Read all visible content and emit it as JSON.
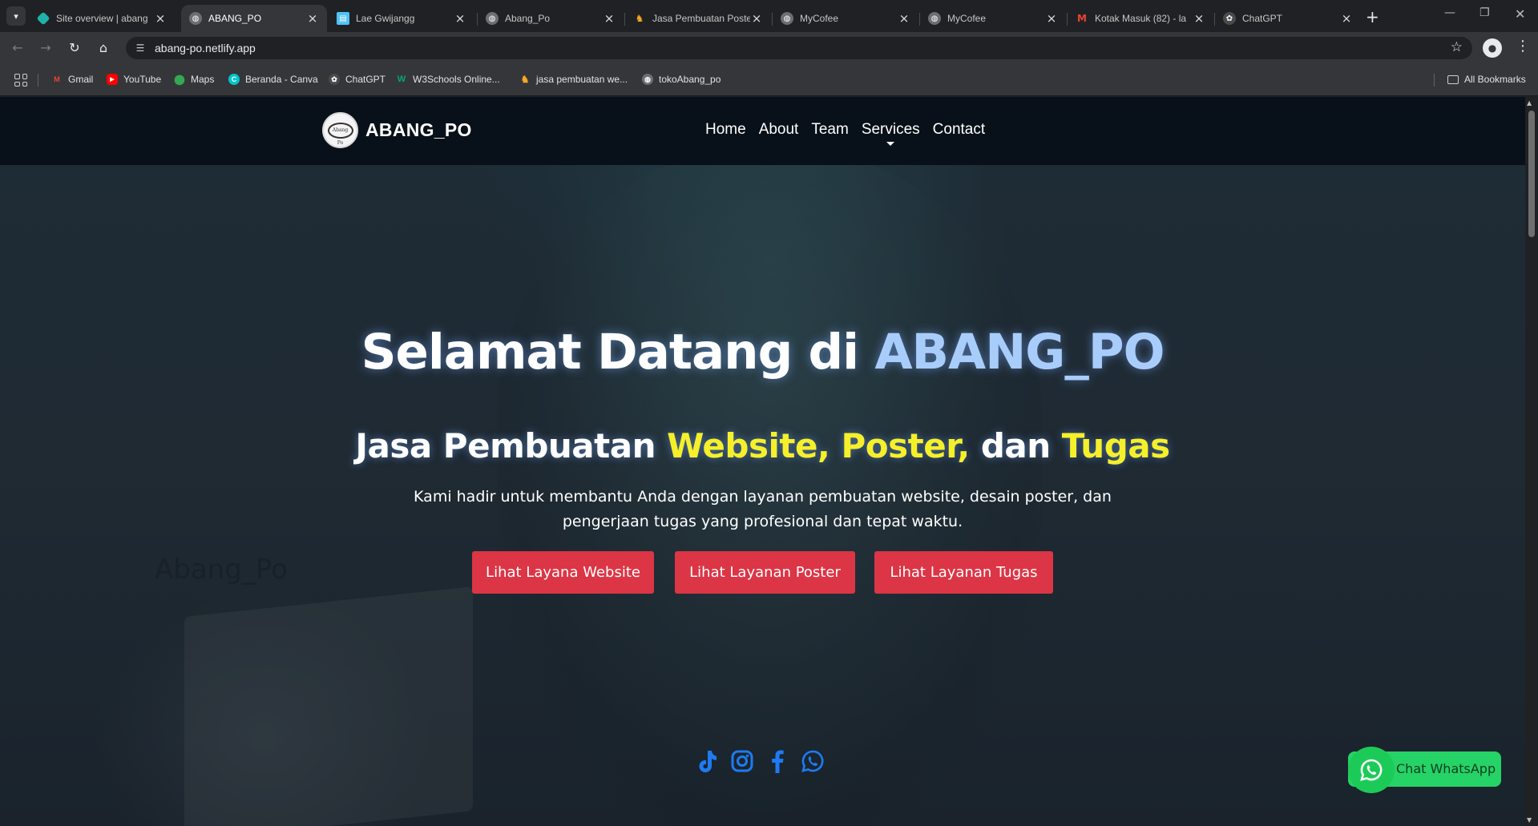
{
  "browser": {
    "tabs": [
      {
        "title": "Site overview | abang",
        "favicon": "netlify-icon",
        "color": "#20b2aa",
        "active": false
      },
      {
        "title": "ABANG_PO",
        "favicon": "globe-icon",
        "color": "#9aa0a6",
        "active": true
      },
      {
        "title": "Lae Gwijangg",
        "favicon": "page-icon",
        "color": "#4fc3f7",
        "active": false
      },
      {
        "title": "Abang_Po",
        "favicon": "globe-icon",
        "color": "#9aa0a6",
        "active": false
      },
      {
        "title": "Jasa Pembuatan Poste",
        "favicon": "figure-icon",
        "color": "#f9a825",
        "active": false
      },
      {
        "title": "MyCofee",
        "favicon": "globe-icon",
        "color": "#9aa0a6",
        "active": false
      },
      {
        "title": "MyCofee",
        "favicon": "globe-icon",
        "color": "#9aa0a6",
        "active": false
      },
      {
        "title": "Kotak Masuk (82) - la",
        "favicon": "gmail-icon",
        "color": "#ea4335",
        "active": false
      },
      {
        "title": "ChatGPT",
        "favicon": "chatgpt-icon",
        "color": "#bdbdbd",
        "active": false
      }
    ],
    "url": "abang-po.netlify.app",
    "bookmarks": [
      {
        "label": "Gmail",
        "icon": "gmail-icon",
        "color": "#ea4335"
      },
      {
        "label": "YouTube",
        "icon": "youtube-icon",
        "color": "#ff0000"
      },
      {
        "label": "Maps",
        "icon": "maps-icon",
        "color": "#34a853"
      },
      {
        "label": "Beranda - Canva",
        "icon": "canva-icon",
        "color": "#00c4cc"
      },
      {
        "label": "ChatGPT",
        "icon": "chatgpt-icon",
        "color": "#bdbdbd"
      },
      {
        "label": "W3Schools Online...",
        "icon": "w3schools-icon",
        "color": "#04aa6d"
      },
      {
        "label": "jasa pembuatan we...",
        "icon": "figure-icon",
        "color": "#f9a825"
      },
      {
        "label": "tokoAbang_po",
        "icon": "globe-icon",
        "color": "#9aa0a6"
      }
    ],
    "all_bookmarks": "All Bookmarks"
  },
  "site": {
    "brand": "ABANG_PO",
    "logo_text": "Abang Po",
    "nav": [
      "Home",
      "About",
      "Team",
      "Services",
      "Contact"
    ],
    "hero": {
      "title_prefix": "Selamat Datang di ",
      "title_accent": "ABANG_PO",
      "subtitle_prefix": "Jasa Pembuatan ",
      "subtitle_hl1": "Website, Poster,",
      "subtitle_mid": " dan ",
      "subtitle_hl2": "Tugas",
      "desc_line1": "Kami hadir untuk membantu Anda dengan layanan pembuatan website, desain poster, dan",
      "desc_line2": "pengerjaan tugas yang profesional dan tepat waktu."
    },
    "watermark": "Abang_Po",
    "buttons": [
      "Lihat Layana Website",
      "Lihat Layanan Poster",
      "Lihat Layanan Tugas"
    ],
    "socials": [
      "tiktok-icon",
      "instagram-icon",
      "facebook-icon",
      "whatsapp-icon"
    ],
    "whatsapp_label": "Chat WhatsApp"
  },
  "colors": {
    "accent_blue": "#a9cdfb",
    "highlight_yellow": "#f5f02a",
    "button_red": "#dc3545",
    "social_blue": "#1877f2",
    "whatsapp_green": "#25d366"
  }
}
